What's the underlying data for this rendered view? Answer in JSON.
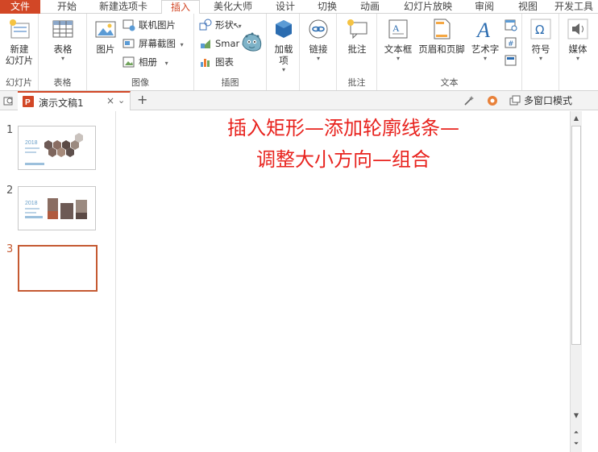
{
  "tabs": [
    "文件",
    "开始",
    "新建选项卡",
    "插入",
    "美化大师",
    "设计",
    "切换",
    "动画",
    "幻灯片放映",
    "审阅",
    "视图",
    "开发工具"
  ],
  "active_tab": "插入",
  "ribbon": {
    "slides": {
      "new_slide": "新建\n幻灯片",
      "label": "幻灯片"
    },
    "tables": {
      "table": "表格",
      "label": "表格"
    },
    "images": {
      "pictures": "图片",
      "online_pictures": "联机图片",
      "screenshot": "屏幕截图",
      "photo_album": "相册",
      "label": "图像"
    },
    "illustrations": {
      "shapes": "形状",
      "smartart": "Smar",
      "chart": "图表",
      "label": "插图"
    },
    "addins": {
      "addins": "加载\n项",
      "label": ""
    },
    "links": {
      "link": "链接",
      "label": ""
    },
    "comments": {
      "comment": "批注",
      "label": "批注"
    },
    "text": {
      "textbox": "文本框",
      "header_footer": "页眉和页脚",
      "wordart": "艺术字",
      "label": "文本"
    },
    "symbols": {
      "symbol": "符号"
    },
    "media": {
      "media": "媒体"
    }
  },
  "doc": {
    "title": "演示文稿1",
    "close": "×",
    "pin": "⌄",
    "add": "+",
    "multiwindow": "多窗口模式"
  },
  "thumbs": {
    "slide1": {
      "num": "1",
      "year": "2018"
    },
    "slide2": {
      "num": "2",
      "year": "2018"
    },
    "slide3": {
      "num": "3"
    }
  },
  "slide": {
    "line1": "插入矩形—添加轮廓线条—",
    "line2": "调整大小方向—组合"
  },
  "colors": {
    "accent": "#d24726",
    "title_text": "#e8231e",
    "selected_thumb": "#c55a32"
  }
}
